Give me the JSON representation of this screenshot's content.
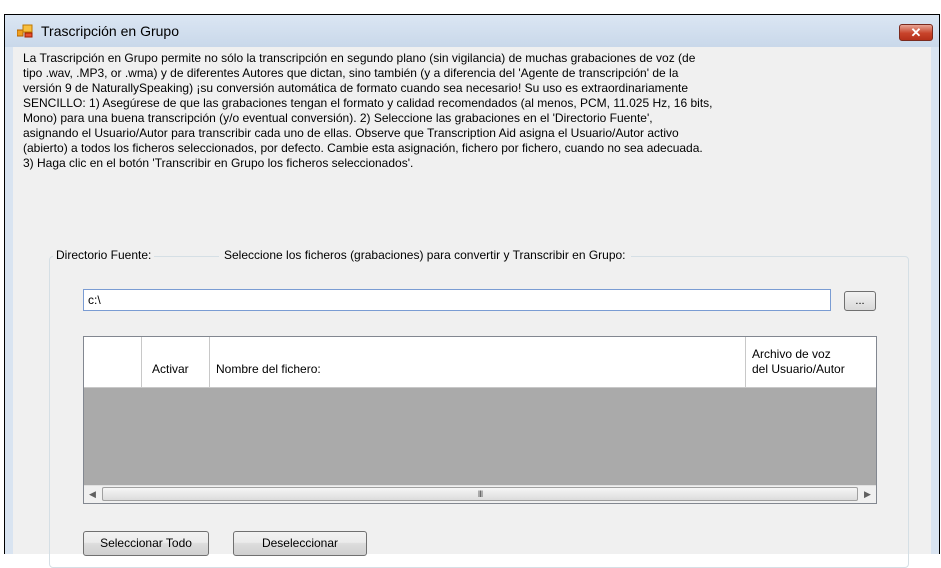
{
  "window": {
    "title": "Trascripción en Grupo",
    "close_glyph": "✕"
  },
  "description": {
    "lines": [
      "La Trascripción en Grupo permite no sólo la transcripción en segundo plano (sin vigilancia) de muchas grabaciones de voz (de",
      "tipo .wav, .MP3, or .wma) y de diferentes Autores que dictan, sino también (y a diferencia del 'Agente de transcripción' de la",
      "versión 9 de NaturallySpeaking) ¡su conversión automática de formato cuando sea necesario! Su uso es extraordinariamente",
      "SENCILLO: 1) Asegúrese de que las grabaciones tengan el formato y calidad recomendados (al menos, PCM, 11.025 Hz, 16 bits,",
      "Mono) para una buena transcripción (y/o eventual conversión). 2) Seleccione las grabaciones en el 'Directorio Fuente',",
      "asignando el Usuario/Autor para transcribir cada uno de ellas. Observe que Transcription Aid asigna el Usuario/Autor activo",
      "(abierto) a todos los ficheros seleccionados, por defecto. Cambie esta asignación, fichero por fichero, cuando no sea adecuada.",
      "3) Haga clic en el botón 'Transcribir en Grupo los ficheros seleccionados'."
    ]
  },
  "source": {
    "label": "Directorio Fuente:",
    "instruction": "Seleccione los ficheros (grabaciones) para convertir y Transcribir en Grupo:",
    "path_value": "c:\\",
    "browse_label": "..."
  },
  "grid": {
    "columns": [
      "Activar",
      "Nombre del fichero:",
      "Archivo de voz",
      "del Usuario/Autor"
    ],
    "scroll_left": "◀",
    "scroll_right": "▶",
    "thumb_grip": "III"
  },
  "buttons": {
    "select_all": "Seleccionar Todo",
    "deselect": "Deseleccionar"
  },
  "colors": {
    "titlebar": "#d9e4f1",
    "close_button": "#c8432a",
    "client_bg": "#f0f0f0"
  }
}
